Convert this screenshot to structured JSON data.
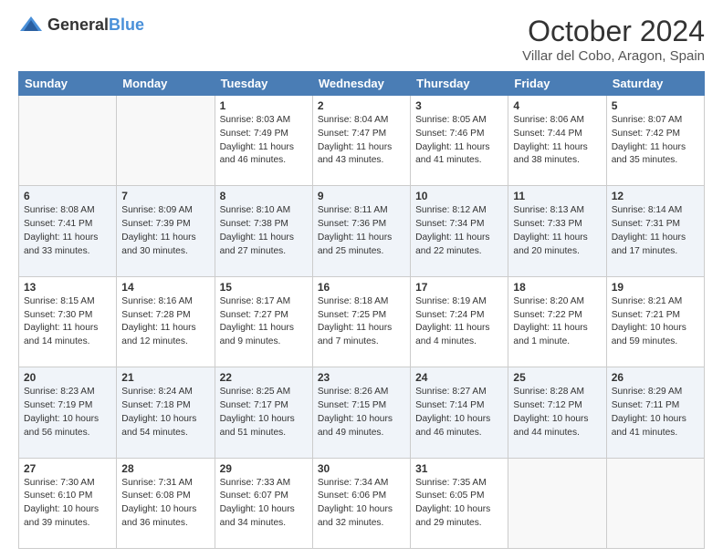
{
  "logo": {
    "general": "General",
    "blue": "Blue"
  },
  "header": {
    "month": "October 2024",
    "location": "Villar del Cobo, Aragon, Spain"
  },
  "days_of_week": [
    "Sunday",
    "Monday",
    "Tuesday",
    "Wednesday",
    "Thursday",
    "Friday",
    "Saturday"
  ],
  "weeks": [
    [
      {
        "day": "",
        "empty": true
      },
      {
        "day": "",
        "empty": true
      },
      {
        "day": "1",
        "sunrise": "Sunrise: 8:03 AM",
        "sunset": "Sunset: 7:49 PM",
        "daylight": "Daylight: 11 hours and 46 minutes."
      },
      {
        "day": "2",
        "sunrise": "Sunrise: 8:04 AM",
        "sunset": "Sunset: 7:47 PM",
        "daylight": "Daylight: 11 hours and 43 minutes."
      },
      {
        "day": "3",
        "sunrise": "Sunrise: 8:05 AM",
        "sunset": "Sunset: 7:46 PM",
        "daylight": "Daylight: 11 hours and 41 minutes."
      },
      {
        "day": "4",
        "sunrise": "Sunrise: 8:06 AM",
        "sunset": "Sunset: 7:44 PM",
        "daylight": "Daylight: 11 hours and 38 minutes."
      },
      {
        "day": "5",
        "sunrise": "Sunrise: 8:07 AM",
        "sunset": "Sunset: 7:42 PM",
        "daylight": "Daylight: 11 hours and 35 minutes."
      }
    ],
    [
      {
        "day": "6",
        "sunrise": "Sunrise: 8:08 AM",
        "sunset": "Sunset: 7:41 PM",
        "daylight": "Daylight: 11 hours and 33 minutes."
      },
      {
        "day": "7",
        "sunrise": "Sunrise: 8:09 AM",
        "sunset": "Sunset: 7:39 PM",
        "daylight": "Daylight: 11 hours and 30 minutes."
      },
      {
        "day": "8",
        "sunrise": "Sunrise: 8:10 AM",
        "sunset": "Sunset: 7:38 PM",
        "daylight": "Daylight: 11 hours and 27 minutes."
      },
      {
        "day": "9",
        "sunrise": "Sunrise: 8:11 AM",
        "sunset": "Sunset: 7:36 PM",
        "daylight": "Daylight: 11 hours and 25 minutes."
      },
      {
        "day": "10",
        "sunrise": "Sunrise: 8:12 AM",
        "sunset": "Sunset: 7:34 PM",
        "daylight": "Daylight: 11 hours and 22 minutes."
      },
      {
        "day": "11",
        "sunrise": "Sunrise: 8:13 AM",
        "sunset": "Sunset: 7:33 PM",
        "daylight": "Daylight: 11 hours and 20 minutes."
      },
      {
        "day": "12",
        "sunrise": "Sunrise: 8:14 AM",
        "sunset": "Sunset: 7:31 PM",
        "daylight": "Daylight: 11 hours and 17 minutes."
      }
    ],
    [
      {
        "day": "13",
        "sunrise": "Sunrise: 8:15 AM",
        "sunset": "Sunset: 7:30 PM",
        "daylight": "Daylight: 11 hours and 14 minutes."
      },
      {
        "day": "14",
        "sunrise": "Sunrise: 8:16 AM",
        "sunset": "Sunset: 7:28 PM",
        "daylight": "Daylight: 11 hours and 12 minutes."
      },
      {
        "day": "15",
        "sunrise": "Sunrise: 8:17 AM",
        "sunset": "Sunset: 7:27 PM",
        "daylight": "Daylight: 11 hours and 9 minutes."
      },
      {
        "day": "16",
        "sunrise": "Sunrise: 8:18 AM",
        "sunset": "Sunset: 7:25 PM",
        "daylight": "Daylight: 11 hours and 7 minutes."
      },
      {
        "day": "17",
        "sunrise": "Sunrise: 8:19 AM",
        "sunset": "Sunset: 7:24 PM",
        "daylight": "Daylight: 11 hours and 4 minutes."
      },
      {
        "day": "18",
        "sunrise": "Sunrise: 8:20 AM",
        "sunset": "Sunset: 7:22 PM",
        "daylight": "Daylight: 11 hours and 1 minute."
      },
      {
        "day": "19",
        "sunrise": "Sunrise: 8:21 AM",
        "sunset": "Sunset: 7:21 PM",
        "daylight": "Daylight: 10 hours and 59 minutes."
      }
    ],
    [
      {
        "day": "20",
        "sunrise": "Sunrise: 8:23 AM",
        "sunset": "Sunset: 7:19 PM",
        "daylight": "Daylight: 10 hours and 56 minutes."
      },
      {
        "day": "21",
        "sunrise": "Sunrise: 8:24 AM",
        "sunset": "Sunset: 7:18 PM",
        "daylight": "Daylight: 10 hours and 54 minutes."
      },
      {
        "day": "22",
        "sunrise": "Sunrise: 8:25 AM",
        "sunset": "Sunset: 7:17 PM",
        "daylight": "Daylight: 10 hours and 51 minutes."
      },
      {
        "day": "23",
        "sunrise": "Sunrise: 8:26 AM",
        "sunset": "Sunset: 7:15 PM",
        "daylight": "Daylight: 10 hours and 49 minutes."
      },
      {
        "day": "24",
        "sunrise": "Sunrise: 8:27 AM",
        "sunset": "Sunset: 7:14 PM",
        "daylight": "Daylight: 10 hours and 46 minutes."
      },
      {
        "day": "25",
        "sunrise": "Sunrise: 8:28 AM",
        "sunset": "Sunset: 7:12 PM",
        "daylight": "Daylight: 10 hours and 44 minutes."
      },
      {
        "day": "26",
        "sunrise": "Sunrise: 8:29 AM",
        "sunset": "Sunset: 7:11 PM",
        "daylight": "Daylight: 10 hours and 41 minutes."
      }
    ],
    [
      {
        "day": "27",
        "sunrise": "Sunrise: 7:30 AM",
        "sunset": "Sunset: 6:10 PM",
        "daylight": "Daylight: 10 hours and 39 minutes."
      },
      {
        "day": "28",
        "sunrise": "Sunrise: 7:31 AM",
        "sunset": "Sunset: 6:08 PM",
        "daylight": "Daylight: 10 hours and 36 minutes."
      },
      {
        "day": "29",
        "sunrise": "Sunrise: 7:33 AM",
        "sunset": "Sunset: 6:07 PM",
        "daylight": "Daylight: 10 hours and 34 minutes."
      },
      {
        "day": "30",
        "sunrise": "Sunrise: 7:34 AM",
        "sunset": "Sunset: 6:06 PM",
        "daylight": "Daylight: 10 hours and 32 minutes."
      },
      {
        "day": "31",
        "sunrise": "Sunrise: 7:35 AM",
        "sunset": "Sunset: 6:05 PM",
        "daylight": "Daylight: 10 hours and 29 minutes."
      },
      {
        "day": "",
        "empty": true
      },
      {
        "day": "",
        "empty": true
      }
    ]
  ]
}
